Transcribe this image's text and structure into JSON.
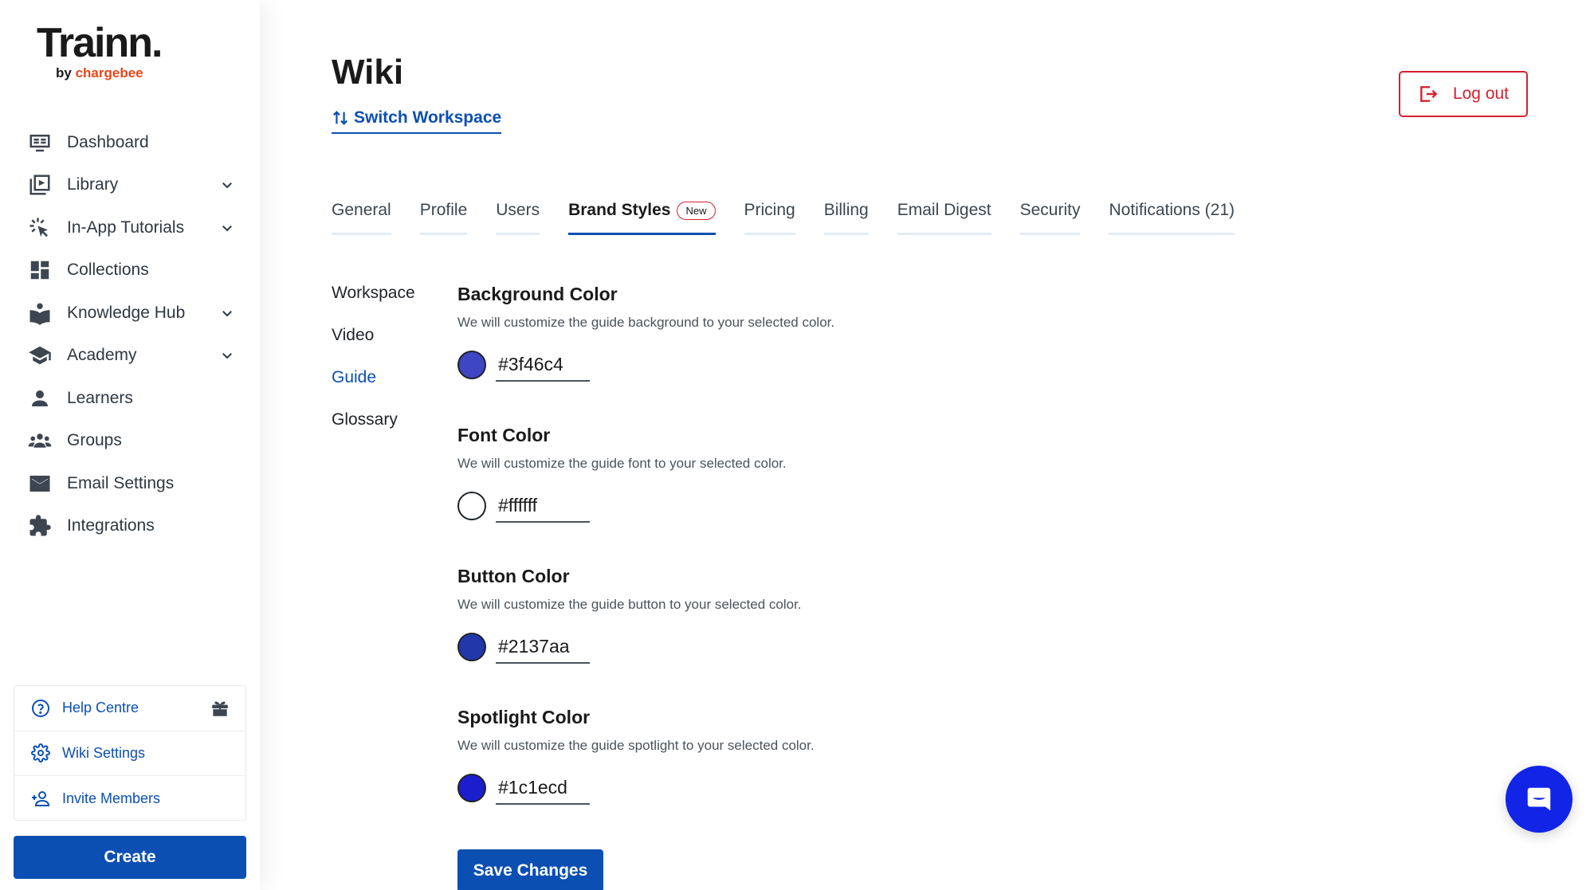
{
  "brand": {
    "name_main": "Trainn.",
    "name_sub_prefix": "by",
    "name_sub_brand": "chargebee",
    "accent": "#e8461a"
  },
  "sidebar": {
    "items": [
      {
        "label": "Dashboard",
        "icon": "dashboard-icon",
        "expandable": false
      },
      {
        "label": "Library",
        "icon": "library-icon",
        "expandable": true
      },
      {
        "label": "In-App Tutorials",
        "icon": "cursor-click-icon",
        "expandable": true
      },
      {
        "label": "Collections",
        "icon": "collections-icon",
        "expandable": false
      },
      {
        "label": "Knowledge Hub",
        "icon": "book-icon",
        "expandable": true
      },
      {
        "label": "Academy",
        "icon": "graduation-cap-icon",
        "expandable": true
      },
      {
        "label": "Learners",
        "icon": "person-icon",
        "expandable": false
      },
      {
        "label": "Groups",
        "icon": "groups-icon",
        "expandable": false
      },
      {
        "label": "Email Settings",
        "icon": "mail-icon",
        "expandable": false
      },
      {
        "label": "Integrations",
        "icon": "puzzle-icon",
        "expandable": false
      }
    ],
    "help": [
      {
        "label": "Help Centre",
        "icon": "help-circle-icon"
      },
      {
        "label": "Wiki Settings",
        "icon": "gear-icon"
      },
      {
        "label": "Invite Members",
        "icon": "add-user-icon"
      }
    ],
    "create_label": "Create"
  },
  "header": {
    "title": "Wiki",
    "switch_workspace": "Switch Workspace",
    "logout": "Log out"
  },
  "tabs": [
    {
      "label": "General",
      "active": false
    },
    {
      "label": "Profile",
      "active": false
    },
    {
      "label": "Users",
      "active": false
    },
    {
      "label": "Brand Styles",
      "active": true,
      "badge": "New"
    },
    {
      "label": "Pricing",
      "active": false
    },
    {
      "label": "Billing",
      "active": false
    },
    {
      "label": "Email Digest",
      "active": false
    },
    {
      "label": "Security",
      "active": false
    },
    {
      "label": "Notifications (21)",
      "active": false
    }
  ],
  "subnav": [
    {
      "label": "Workspace",
      "active": false
    },
    {
      "label": "Video",
      "active": false
    },
    {
      "label": "Guide",
      "active": true
    },
    {
      "label": "Glossary",
      "active": false
    }
  ],
  "settings": [
    {
      "title": "Background Color",
      "description": "We will customize the guide background to your selected color.",
      "value": "#3f46c4"
    },
    {
      "title": "Font Color",
      "description": "We will customize the guide font to your selected color.",
      "value": "#ffffff"
    },
    {
      "title": "Button Color",
      "description": "We will customize the guide button to your selected color.",
      "value": "#2137aa"
    },
    {
      "title": "Spotlight Color",
      "description": "We will customize the guide spotlight to your selected color.",
      "value": "#1c1ecd"
    }
  ],
  "save_label": "Save Changes",
  "colors": {
    "primary": "#0b4fb3",
    "danger": "#d6202f",
    "chat": "#1224e6"
  }
}
